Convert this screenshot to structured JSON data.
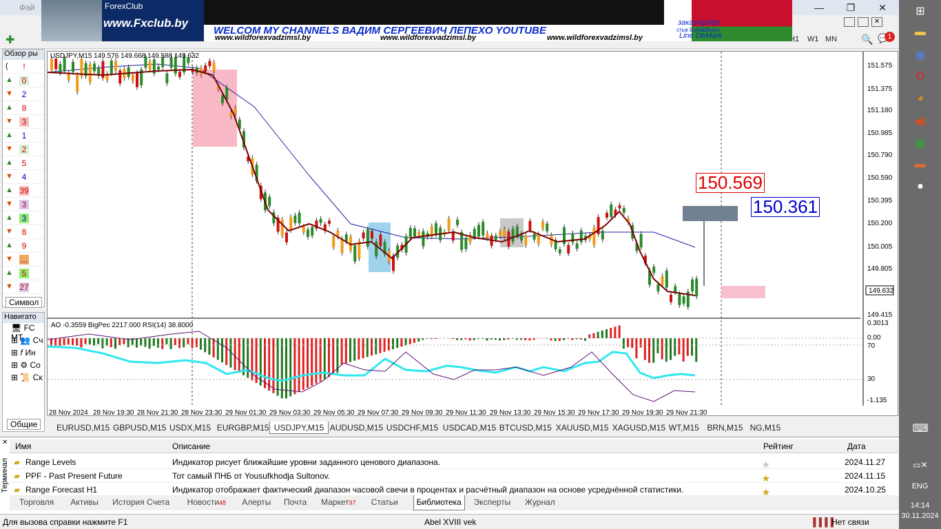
{
  "window": {
    "menu_first": "Фай",
    "timeframes": [
      "H1",
      "W1",
      "MN"
    ],
    "notif_count": "1"
  },
  "banner": {
    "fx_title": "ForexClub",
    "fx_site": "www.Fxclub.by",
    "welcome": "WELCOM MY CHANNELS ВАДИМ СЕРГЕЕВИЧ ЛЕПЕХО YOUTUBE",
    "site1": "www.wildforexvadzimsl.by",
    "site2": "www.wildforexvadzimsl.by",
    "site3": "www.wildforexvadzimsl.by",
    "order": "заказ/ордер",
    "stuck": "стык Bulls&Bears",
    "demark": "Line DeMark"
  },
  "market_watch": {
    "title": "Обзор ры",
    "col1": "(",
    "col2": "!",
    "rows": [
      "0",
      "2",
      "8",
      "3",
      "1",
      "2",
      "5",
      "4",
      "39",
      "3",
      "3",
      "8",
      "9",
      "...",
      "5",
      "27"
    ],
    "tab_label": "Символ"
  },
  "navigator": {
    "title": "Навигато",
    "items": [
      "FC MT",
      "Сч",
      "Ин",
      "Со",
      "Ск"
    ],
    "tab_label": "Общие"
  },
  "chart": {
    "header": "USDJPY,M15  149.576 149.668 149.588 149.632",
    "price_labels": [
      "151.575",
      "151.375",
      "151.180",
      "150.985",
      "150.790",
      "150.590",
      "150.395",
      "150.200",
      "150.005",
      "149.805",
      "149.632",
      "149.415"
    ],
    "current_price": "149.632",
    "level_red": "150.569",
    "level_blue": "150.361",
    "indicator_header": "AO -0.3559  BigPec 2217.000  RSI(14) 38.8000",
    "ind_labels": [
      "0.3013",
      "0.00",
      "70",
      "30",
      "-1.135"
    ],
    "time_labels": [
      "28 Nov 2024",
      "28 Nov 19:30",
      "28 Nov 21:30",
      "28 Nov 23:30",
      "29 Nov 01:30",
      "29 Nov 03:30",
      "29 Nov 05:30",
      "29 Nov 07:30",
      "29 Nov 09:30",
      "29 Nov 11:30",
      "29 Nov 13:30",
      "29 Nov 15:30",
      "29 Nov 17:30",
      "29 Nov 19:30",
      "29 Nov 21:30"
    ]
  },
  "chart_tabs": [
    "EURUSD,M15",
    "GBPUSD,M15",
    "USDX,M15",
    "EURGBP,M15",
    "USDJPY,M15",
    "AUDUSD,M15",
    "USDCHF,M15",
    "USDCAD,M15",
    "BTCUSD,M15",
    "XAUUSD,M15",
    "XAGUSD,M15",
    "WT,M15",
    "BRN,M15",
    "NG,M15"
  ],
  "terminal": {
    "side_label": "Терминал",
    "columns": {
      "name": "Имя",
      "desc": "Описание",
      "rating": "Рейтинг",
      "date": "Дата"
    },
    "rows": [
      {
        "name": "Range Levels",
        "desc": "Индикатор рисует ближайшие уровни заданного ценового диапазона.",
        "date": "2024.11.27",
        "stars": 0
      },
      {
        "name": "PPF - Past Present Future",
        "desc": "Тот самый ПНБ от Yousufkhodja Sultonov.",
        "date": "2024.11.15",
        "stars": 5
      },
      {
        "name": "Range Forecast H1",
        "desc": "Индикатор отображает фактический диапазон часовой свечи в процентах и расчётный диапазон на основе усреднённой статистики.",
        "date": "2024.10.25",
        "stars": 5
      }
    ],
    "tabs": [
      {
        "label": "Торговля"
      },
      {
        "label": "Активы"
      },
      {
        "label": "История Счета"
      },
      {
        "label": "Новости",
        "badge": "48"
      },
      {
        "label": "Алерты"
      },
      {
        "label": "Почта"
      },
      {
        "label": "Маркет",
        "badge": "97"
      },
      {
        "label": "Статьи"
      },
      {
        "label": "Библиотека"
      },
      {
        "label": "Эксперты"
      },
      {
        "label": "Журнал"
      }
    ]
  },
  "status": {
    "help": "Для вызова справки нажмите F1",
    "profile": "Abel XVIII vek",
    "connection": "Нет связи"
  },
  "taskbar": {
    "lang": "ENG",
    "time": "14:14",
    "date": "30.11.2024"
  }
}
